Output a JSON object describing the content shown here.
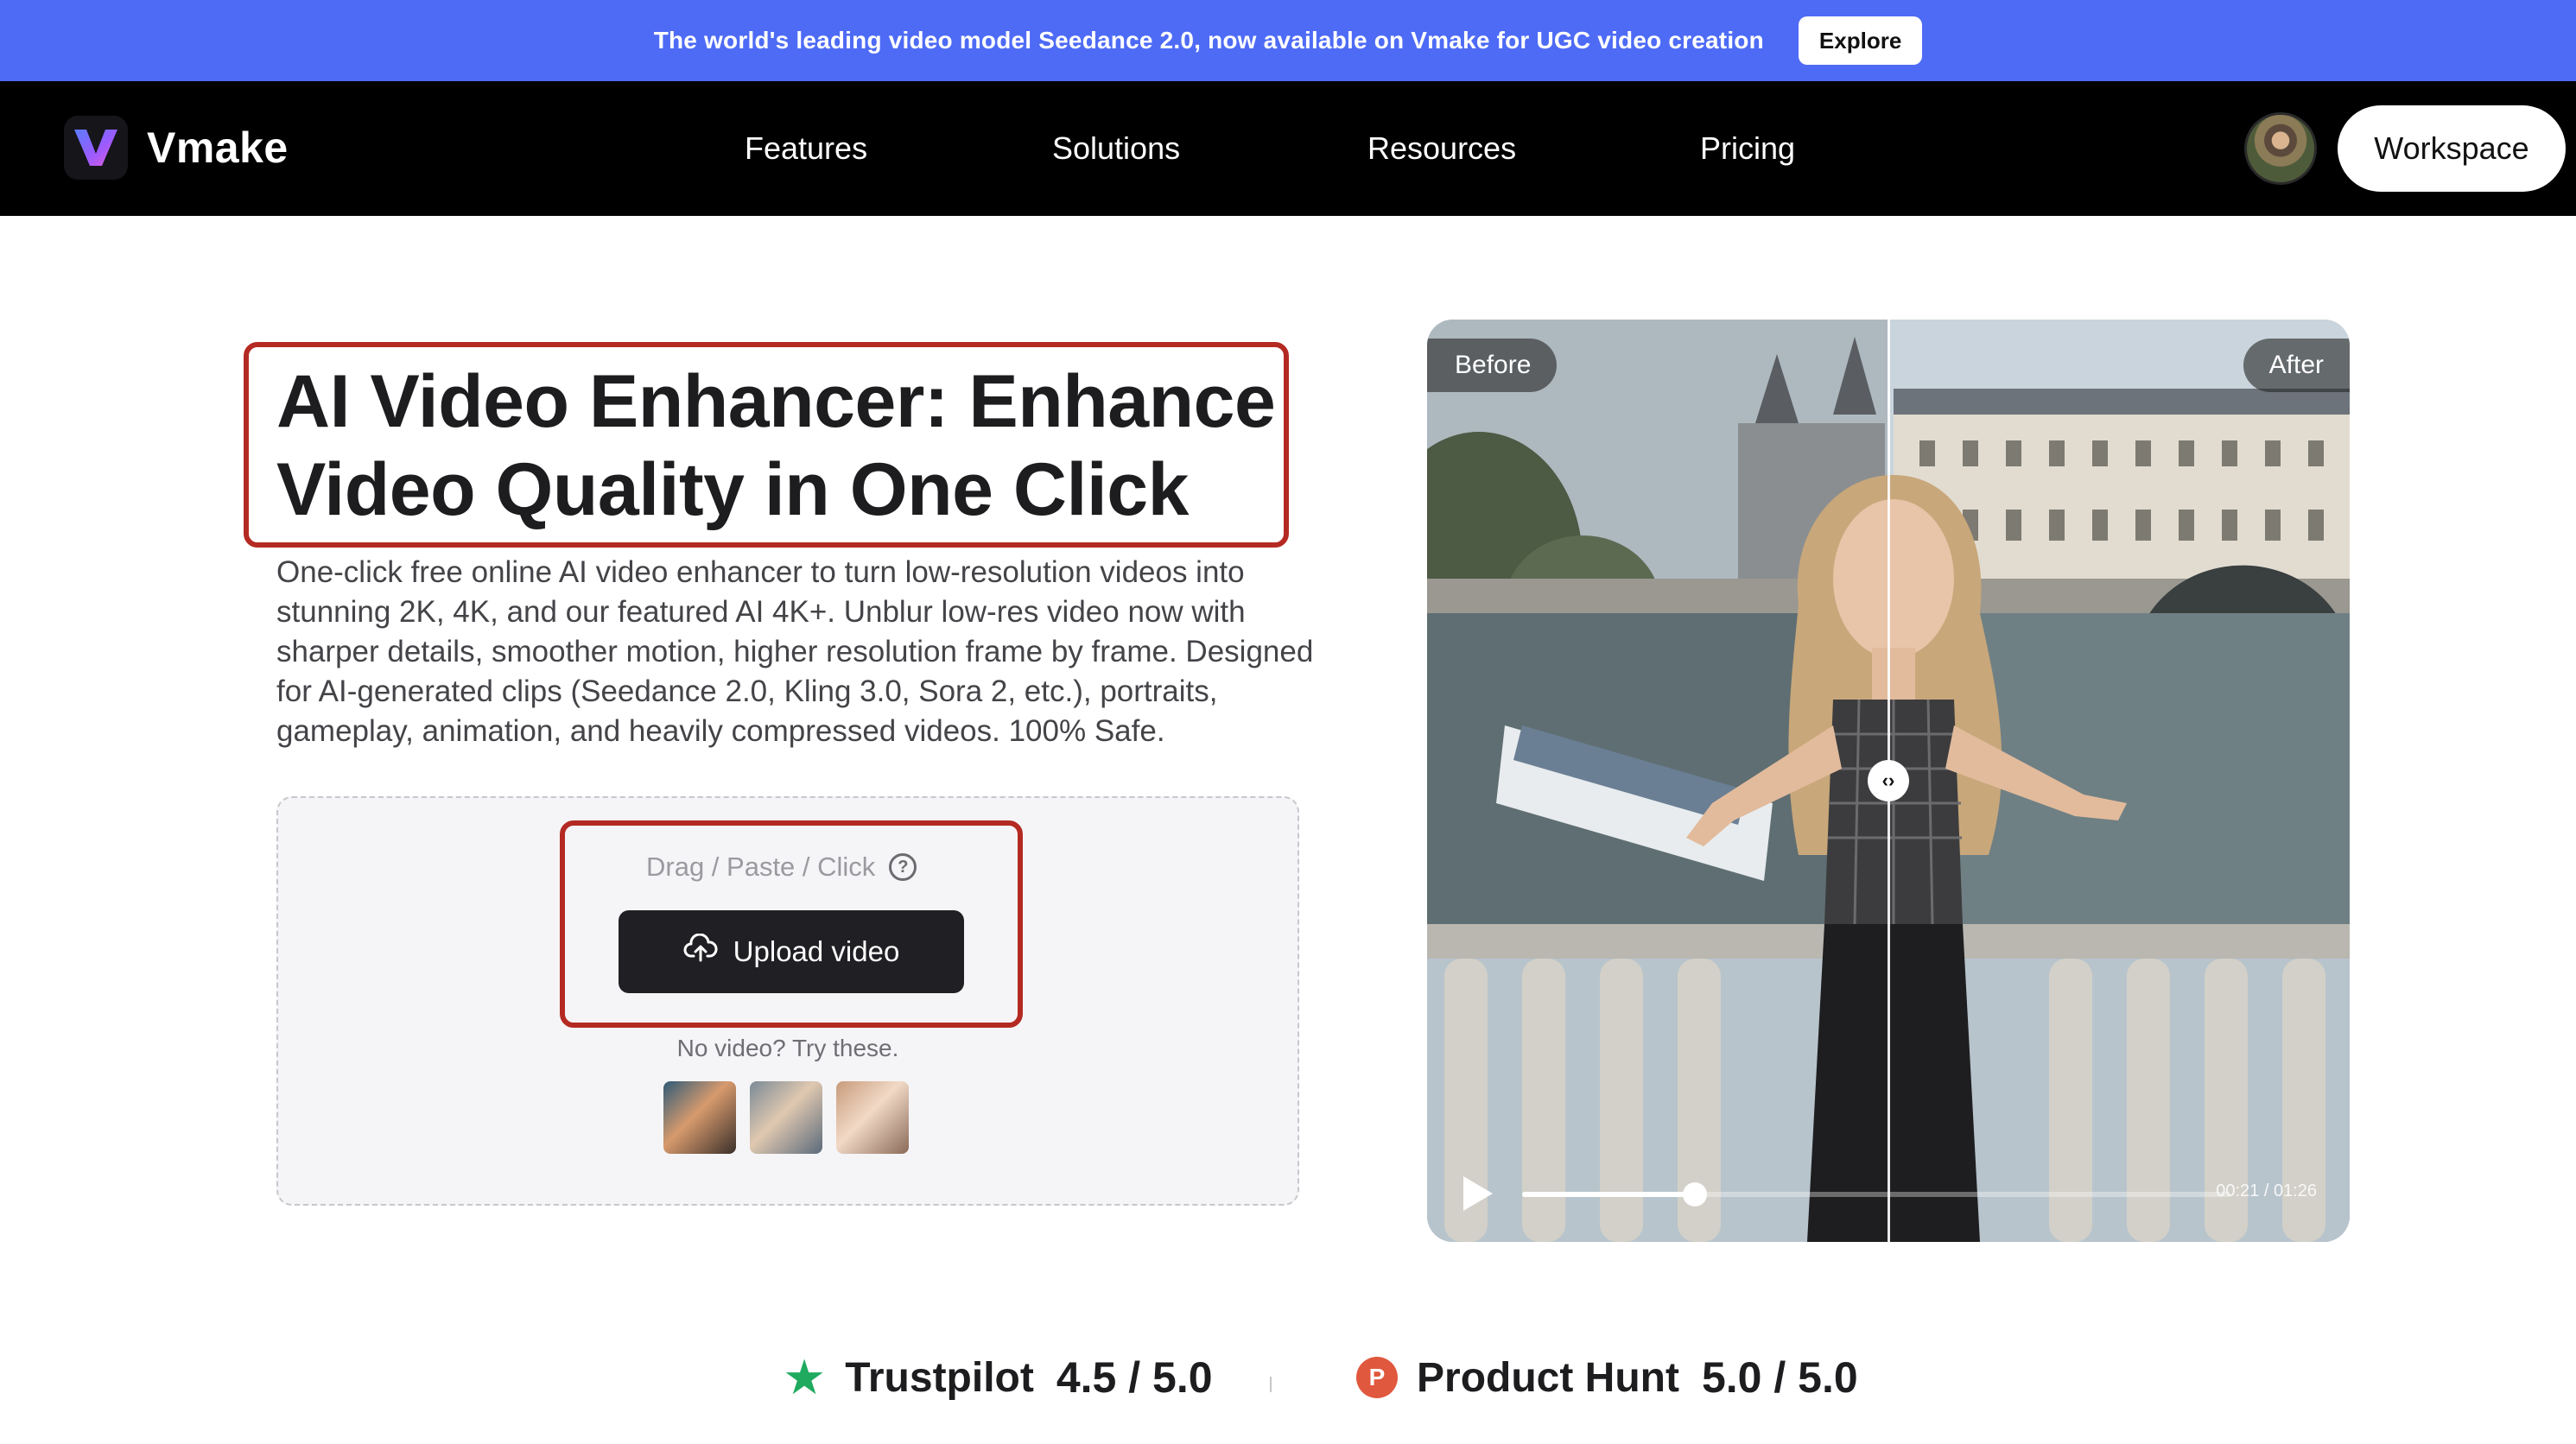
{
  "banner": {
    "text": "The world's leading video model Seedance 2.0, now available on Vmake for UGC video creation",
    "button": "Explore"
  },
  "nav": {
    "brand": "Vmake",
    "items": [
      "Features",
      "Solutions",
      "Resources",
      "Pricing"
    ],
    "workspace": "Workspace"
  },
  "hero": {
    "title_line1": "AI Video Enhancer: Enhance",
    "title_line2": "Video Quality in One Click",
    "description": "One-click free online AI video enhancer to turn low-resolution videos into stunning 2K, 4K, and our featured AI 4K+. Unblur low-res video now with sharper details, smoother motion, higher resolution frame by frame. Designed for AI-generated clips (Seedance 2.0, Kling 3.0, Sora 2, etc.), portraits, gameplay, animation, and heavily compressed videos. 100% Safe."
  },
  "upload": {
    "hint": "Drag / Paste / Click",
    "help_icon": "question-circle-icon",
    "button": "Upload video",
    "button_icon": "cloud-upload-icon",
    "try_text": "No video? Try these.",
    "sample_count_label": "3"
  },
  "comparison": {
    "before_label": "Before",
    "after_label": "After",
    "time": "00:21 / 01:26",
    "progress_fraction": 0.244,
    "split_fraction": 0.5
  },
  "ratings": {
    "trustpilot_name": "Trustpilot",
    "trustpilot_score": "4.5 / 5.0",
    "producthunt_name": "Product Hunt",
    "producthunt_score": "5.0 / 5.0",
    "producthunt_icon_letter": "P"
  },
  "colors": {
    "banner": "#4e6bf6",
    "nav": "#000000",
    "highlight": "#b42a22",
    "button_dark": "#202024",
    "trustpilot": "#1faa5f",
    "producthunt": "#e0583e"
  }
}
